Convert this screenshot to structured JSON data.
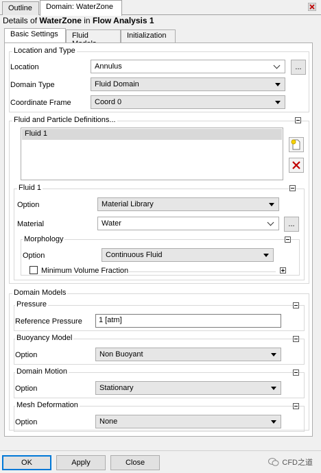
{
  "top_tabs": [
    "Outline",
    "Domain: WaterZone"
  ],
  "header": {
    "prefix": "Details of ",
    "object": "WaterZone",
    "middle": " in ",
    "context": "Flow Analysis 1"
  },
  "inner_tabs": [
    "Basic Settings",
    "Fluid Models",
    "Initialization"
  ],
  "location_type": {
    "title": "Location and Type",
    "location_label": "Location",
    "location_value": "Annulus",
    "domain_type_label": "Domain Type",
    "domain_type_value": "Fluid Domain",
    "coord_label": "Coordinate Frame",
    "coord_value": "Coord 0"
  },
  "fluid_defs": {
    "title": "Fluid and Particle Definitions...",
    "items": [
      "Fluid 1"
    ],
    "fluid1": {
      "title": "Fluid 1",
      "option_label": "Option",
      "option_value": "Material Library",
      "material_label": "Material",
      "material_value": "Water",
      "morphology": {
        "title": "Morphology",
        "option_label": "Option",
        "option_value": "Continuous Fluid",
        "min_volume_label": "Minimum Volume Fraction"
      }
    }
  },
  "domain_models": {
    "title": "Domain Models",
    "pressure": {
      "title": "Pressure",
      "label": "Reference Pressure",
      "value": "1 [atm]"
    },
    "buoyancy": {
      "title": "Buoyancy Model",
      "label": "Option",
      "value": "Non Buoyant"
    },
    "motion": {
      "title": "Domain Motion",
      "label": "Option",
      "value": "Stationary"
    },
    "mesh": {
      "title": "Mesh Deformation",
      "label": "Option",
      "value": "None"
    }
  },
  "ellipsis": "...",
  "buttons": {
    "ok": "OK",
    "apply": "Apply",
    "close": "Close"
  },
  "watermark": "CFD之道"
}
